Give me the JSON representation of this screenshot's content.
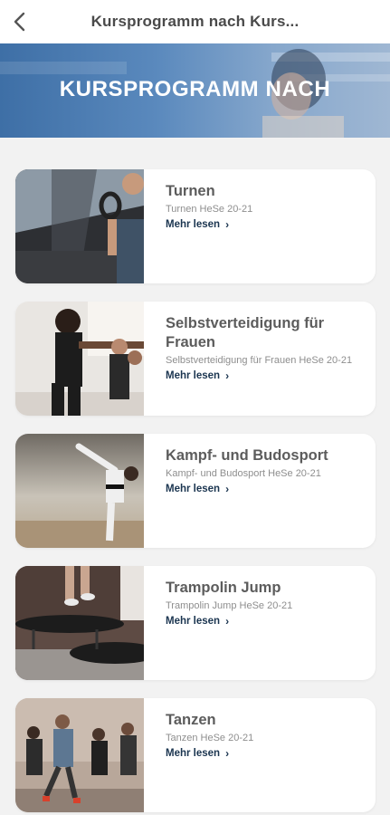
{
  "header": {
    "back_label": "<",
    "title": "Kursprogramm nach Kurs..."
  },
  "hero": {
    "title": "KURSPROGRAMM NACH"
  },
  "courses": [
    {
      "name": "Turnen",
      "subtitle": "Turnen HeSe 20-21",
      "more": "Mehr lesen"
    },
    {
      "name": "Selbstverteidigung für Frauen",
      "subtitle": "Selbstverteidigung für Frauen HeSe 20-21",
      "more": "Mehr lesen"
    },
    {
      "name": "Kampf- und Budosport",
      "subtitle": "Kampf- und Budosport HeSe 20-21",
      "more": "Mehr lesen"
    },
    {
      "name": "Trampolin Jump",
      "subtitle": "Trampolin Jump HeSe 20-21",
      "more": "Mehr lesen"
    },
    {
      "name": "Tanzen",
      "subtitle": "Tanzen HeSe 20-21",
      "more": "Mehr lesen"
    }
  ],
  "icons": {
    "back": "chevron-left-icon",
    "more": "chevron-right-icon"
  },
  "colors": {
    "accent": "#1b3550",
    "hero": "#4f80b8"
  }
}
